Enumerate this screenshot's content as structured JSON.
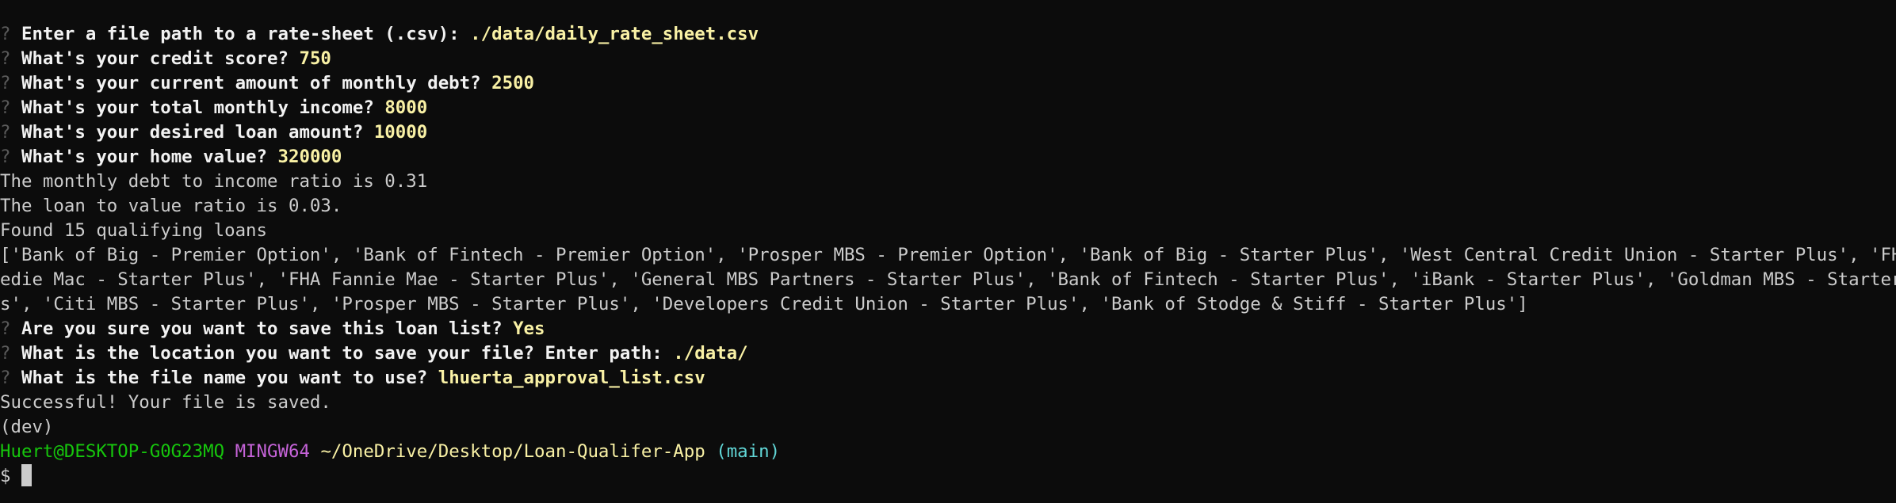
{
  "prompts": [
    {
      "marker": "?",
      "question": "Enter a file path to a rate-sheet (.csv):",
      "answer": "./data/daily_rate_sheet.csv"
    },
    {
      "marker": "?",
      "question": "What's your credit score?",
      "answer": "750"
    },
    {
      "marker": "?",
      "question": "What's your current amount of monthly debt?",
      "answer": "2500"
    },
    {
      "marker": "?",
      "question": "What's your total monthly income?",
      "answer": "8000"
    },
    {
      "marker": "?",
      "question": "What's your desired loan amount?",
      "answer": "10000"
    },
    {
      "marker": "?",
      "question": "What's your home value?",
      "answer": "320000"
    }
  ],
  "output_lines": [
    "The monthly debt to income ratio is 0.31",
    "The loan to value ratio is 0.03.",
    "Found 15 qualifying loans",
    "['Bank of Big - Premier Option', 'Bank of Fintech - Premier Option', 'Prosper MBS - Premier Option', 'Bank of Big - Starter Plus', 'West Central Credit Union - Starter Plus', 'FHA Fr",
    "edie Mac - Starter Plus', 'FHA Fannie Mae - Starter Plus', 'General MBS Partners - Starter Plus', 'Bank of Fintech - Starter Plus', 'iBank - Starter Plus', 'Goldman MBS - Starter Plu",
    "s', 'Citi MBS - Starter Plus', 'Prosper MBS - Starter Plus', 'Developers Credit Union - Starter Plus', 'Bank of Stodge & Stiff - Starter Plus']"
  ],
  "save_prompts": [
    {
      "marker": "?",
      "question": "Are you sure you want to save this loan list?",
      "answer": "Yes"
    },
    {
      "marker": "?",
      "question": "What is the location you want to save your file? Enter path:",
      "answer": "./data/"
    },
    {
      "marker": "?",
      "question": "What is the file name you want to use?",
      "answer": "lhuerta_approval_list.csv"
    }
  ],
  "result": "Successful! Your file is saved.",
  "env": "(dev)",
  "shell_prompt": {
    "user_host": "Huert@DESKTOP-G0G23MQ",
    "system": "MINGW64",
    "path": "~/OneDrive/Desktop/Loan-Qualifer-App",
    "branch": "(main)",
    "symbol": "$"
  },
  "colors": {
    "background": "#0c0c0c",
    "text": "#cccccc",
    "answer": "#f9f1a5",
    "user_host": "#16c60c",
    "system": "#c563d8",
    "branch": "#61d6d6"
  }
}
